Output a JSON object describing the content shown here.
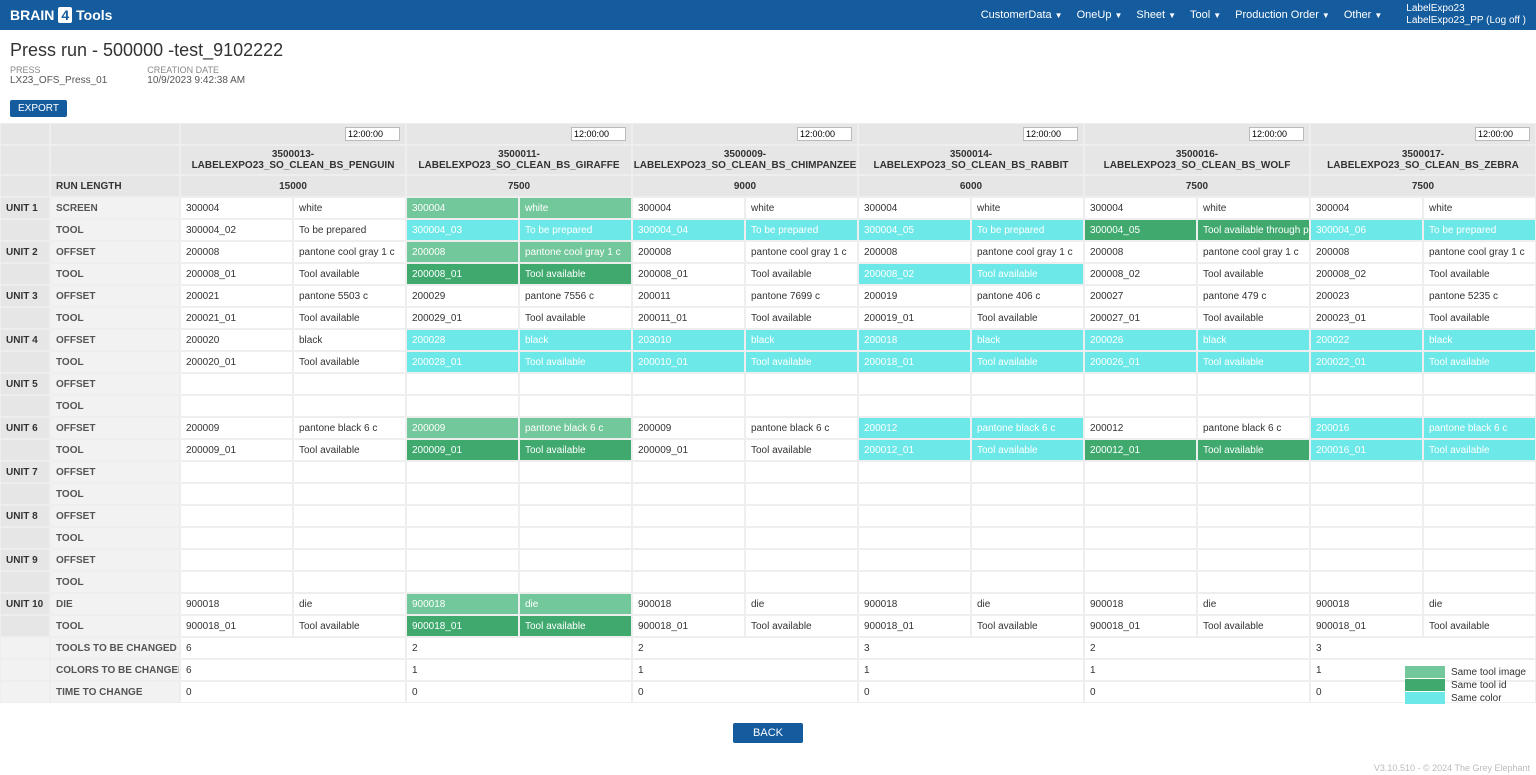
{
  "brand": {
    "pre": "BRAIN",
    "num": "4",
    "post": "Tools"
  },
  "nav": {
    "customer": "CustomerData",
    "oneup": "OneUp",
    "sheet": "Sheet",
    "tool": "Tool",
    "po": "Production Order",
    "other": "Other"
  },
  "user": {
    "line1": "LabelExpo23",
    "line2": "LabelExpo23_PP (Log off )"
  },
  "title": "Press run - 500000 -test_9102222",
  "meta": {
    "press_label": "PRESS",
    "press_val": "LX23_OFS_Press_01",
    "date_label": "CREATION DATE",
    "date_val": "10/9/2023 9:42:38 AM"
  },
  "export": "EXPORT",
  "hdr": {
    "runlength": "RUN LENGTH",
    "time": "12:00:00"
  },
  "jobs": [
    {
      "name": "3500013-LABELEXPO23_SO_CLEAN_BS_PENGUIN",
      "run": "15000"
    },
    {
      "name": "3500011-LABELEXPO23_SO_CLEAN_BS_GIRAFFE",
      "run": "7500"
    },
    {
      "name": "3500009-LABELEXPO23_SO_CLEAN_BS_CHIMPANZEE",
      "run": "9000"
    },
    {
      "name": "3500014-LABELEXPO23_SO_CLEAN_BS_RABBIT",
      "run": "6000"
    },
    {
      "name": "3500016-LABELEXPO23_SO_CLEAN_BS_WOLF",
      "run": "7500"
    },
    {
      "name": "3500017-LABELEXPO23_SO_CLEAN_BS_ZEBRA",
      "run": "7500"
    }
  ],
  "unit_labels": {
    "screen": "SCREEN",
    "offset": "OFFSET",
    "tool": "TOOL",
    "die": "DIE"
  },
  "units": [
    "UNIT 1",
    "UNIT 2",
    "UNIT 3",
    "UNIT 4",
    "UNIT 5",
    "UNIT 6",
    "UNIT 7",
    "UNIT 8",
    "UNIT 9",
    "UNIT 10"
  ],
  "summary_labels": {
    "tools": "TOOLS TO BE CHANGED",
    "colors": "COLORS TO BE CHANGED",
    "time": "TIME TO CHANGE"
  },
  "rows": {
    "u1a": [
      [
        "300004",
        "white",
        ""
      ],
      [
        "300004",
        "white",
        "img"
      ],
      [
        "300004",
        "white",
        ""
      ],
      [
        "300004",
        "white",
        ""
      ],
      [
        "300004",
        "white",
        ""
      ],
      [
        "300004",
        "white",
        ""
      ]
    ],
    "u1b": [
      [
        "300004_02",
        "To be prepared",
        ""
      ],
      [
        "300004_03",
        "To be prepared",
        "col"
      ],
      [
        "300004_04",
        "To be prepared",
        "col"
      ],
      [
        "300004_05",
        "To be prepared",
        "col"
      ],
      [
        "300004_05",
        "Tool available through previously job",
        "id"
      ],
      [
        "300004_06",
        "To be prepared",
        "col"
      ]
    ],
    "u2a": [
      [
        "200008",
        "pantone cool gray 1 c",
        ""
      ],
      [
        "200008",
        "pantone cool gray 1 c",
        "img"
      ],
      [
        "200008",
        "pantone cool gray 1 c",
        ""
      ],
      [
        "200008",
        "pantone cool gray 1 c",
        ""
      ],
      [
        "200008",
        "pantone cool gray 1 c",
        ""
      ],
      [
        "200008",
        "pantone cool gray 1 c",
        ""
      ]
    ],
    "u2b": [
      [
        "200008_01",
        "Tool available",
        ""
      ],
      [
        "200008_01",
        "Tool available",
        "id"
      ],
      [
        "200008_01",
        "Tool available",
        ""
      ],
      [
        "200008_02",
        "Tool available",
        "col"
      ],
      [
        "200008_02",
        "Tool available",
        ""
      ],
      [
        "200008_02",
        "Tool available",
        ""
      ]
    ],
    "u3a": [
      [
        "200021",
        "pantone 5503 c",
        ""
      ],
      [
        "200029",
        "pantone 7556 c",
        ""
      ],
      [
        "200011",
        "pantone 7699 c",
        ""
      ],
      [
        "200019",
        "pantone 406 c",
        ""
      ],
      [
        "200027",
        "pantone 479 c",
        ""
      ],
      [
        "200023",
        "pantone 5235 c",
        ""
      ]
    ],
    "u3b": [
      [
        "200021_01",
        "Tool available",
        ""
      ],
      [
        "200029_01",
        "Tool available",
        ""
      ],
      [
        "200011_01",
        "Tool available",
        ""
      ],
      [
        "200019_01",
        "Tool available",
        ""
      ],
      [
        "200027_01",
        "Tool available",
        ""
      ],
      [
        "200023_01",
        "Tool available",
        ""
      ]
    ],
    "u4a": [
      [
        "200020",
        "black",
        ""
      ],
      [
        "200028",
        "black",
        "col"
      ],
      [
        "203010",
        "black",
        "col"
      ],
      [
        "200018",
        "black",
        "col"
      ],
      [
        "200026",
        "black",
        "col"
      ],
      [
        "200022",
        "black",
        "col"
      ]
    ],
    "u4b": [
      [
        "200020_01",
        "Tool available",
        ""
      ],
      [
        "200028_01",
        "Tool available",
        "col"
      ],
      [
        "200010_01",
        "Tool available",
        "col"
      ],
      [
        "200018_01",
        "Tool available",
        "col"
      ],
      [
        "200026_01",
        "Tool available",
        "col"
      ],
      [
        "200022_01",
        "Tool available",
        "col"
      ]
    ],
    "u5a": [
      [
        "",
        "",
        ""
      ],
      [
        "",
        "",
        ""
      ],
      [
        "",
        "",
        ""
      ],
      [
        "",
        "",
        ""
      ],
      [
        "",
        "",
        ""
      ],
      [
        "",
        "",
        ""
      ]
    ],
    "u5b": [
      [
        "",
        "",
        ""
      ],
      [
        "",
        "",
        ""
      ],
      [
        "",
        "",
        ""
      ],
      [
        "",
        "",
        ""
      ],
      [
        "",
        "",
        ""
      ],
      [
        "",
        "",
        ""
      ]
    ],
    "u6a": [
      [
        "200009",
        "pantone black 6 c",
        ""
      ],
      [
        "200009",
        "pantone black 6 c",
        "img"
      ],
      [
        "200009",
        "pantone black 6 c",
        ""
      ],
      [
        "200012",
        "pantone black 6 c",
        "col"
      ],
      [
        "200012",
        "pantone black 6 c",
        ""
      ],
      [
        "200016",
        "pantone black 6 c",
        "col"
      ]
    ],
    "u6b": [
      [
        "200009_01",
        "Tool available",
        ""
      ],
      [
        "200009_01",
        "Tool available",
        "id"
      ],
      [
        "200009_01",
        "Tool available",
        ""
      ],
      [
        "200012_01",
        "Tool available",
        "col"
      ],
      [
        "200012_01",
        "Tool available",
        "id"
      ],
      [
        "200016_01",
        "Tool available",
        "col"
      ]
    ],
    "u7a": [
      [
        "",
        "",
        ""
      ],
      [
        "",
        "",
        ""
      ],
      [
        "",
        "",
        ""
      ],
      [
        "",
        "",
        ""
      ],
      [
        "",
        "",
        ""
      ],
      [
        "",
        "",
        ""
      ]
    ],
    "u7b": [
      [
        "",
        "",
        ""
      ],
      [
        "",
        "",
        ""
      ],
      [
        "",
        "",
        ""
      ],
      [
        "",
        "",
        ""
      ],
      [
        "",
        "",
        ""
      ],
      [
        "",
        "",
        ""
      ]
    ],
    "u8a": [
      [
        "",
        "",
        ""
      ],
      [
        "",
        "",
        ""
      ],
      [
        "",
        "",
        ""
      ],
      [
        "",
        "",
        ""
      ],
      [
        "",
        "",
        ""
      ],
      [
        "",
        "",
        ""
      ]
    ],
    "u8b": [
      [
        "",
        "",
        ""
      ],
      [
        "",
        "",
        ""
      ],
      [
        "",
        "",
        ""
      ],
      [
        "",
        "",
        ""
      ],
      [
        "",
        "",
        ""
      ],
      [
        "",
        "",
        ""
      ]
    ],
    "u9a": [
      [
        "",
        "",
        ""
      ],
      [
        "",
        "",
        ""
      ],
      [
        "",
        "",
        ""
      ],
      [
        "",
        "",
        ""
      ],
      [
        "",
        "",
        ""
      ],
      [
        "",
        "",
        ""
      ]
    ],
    "u9b": [
      [
        "",
        "",
        ""
      ],
      [
        "",
        "",
        ""
      ],
      [
        "",
        "",
        ""
      ],
      [
        "",
        "",
        ""
      ],
      [
        "",
        "",
        ""
      ],
      [
        "",
        "",
        ""
      ]
    ],
    "u10a": [
      [
        "900018",
        "die",
        ""
      ],
      [
        "900018",
        "die",
        "img"
      ],
      [
        "900018",
        "die",
        ""
      ],
      [
        "900018",
        "die",
        ""
      ],
      [
        "900018",
        "die",
        ""
      ],
      [
        "900018",
        "die",
        ""
      ]
    ],
    "u10b": [
      [
        "900018_01",
        "Tool available",
        ""
      ],
      [
        "900018_01",
        "Tool available",
        "id"
      ],
      [
        "900018_01",
        "Tool available",
        ""
      ],
      [
        "900018_01",
        "Tool available",
        ""
      ],
      [
        "900018_01",
        "Tool available",
        ""
      ],
      [
        "900018_01",
        "Tool available",
        ""
      ]
    ]
  },
  "summary": {
    "tools": [
      "6",
      "2",
      "2",
      "3",
      "2",
      "3"
    ],
    "colors": [
      "6",
      "1",
      "1",
      "1",
      "1",
      "1"
    ],
    "time": [
      "0",
      "0",
      "0",
      "0",
      "0",
      "0"
    ]
  },
  "legend": {
    "img": "Same tool image",
    "id": "Same tool id",
    "col": "Same color"
  },
  "back": "BACK",
  "footer": "V3.10.510 - © 2024 The Grey Elephant"
}
